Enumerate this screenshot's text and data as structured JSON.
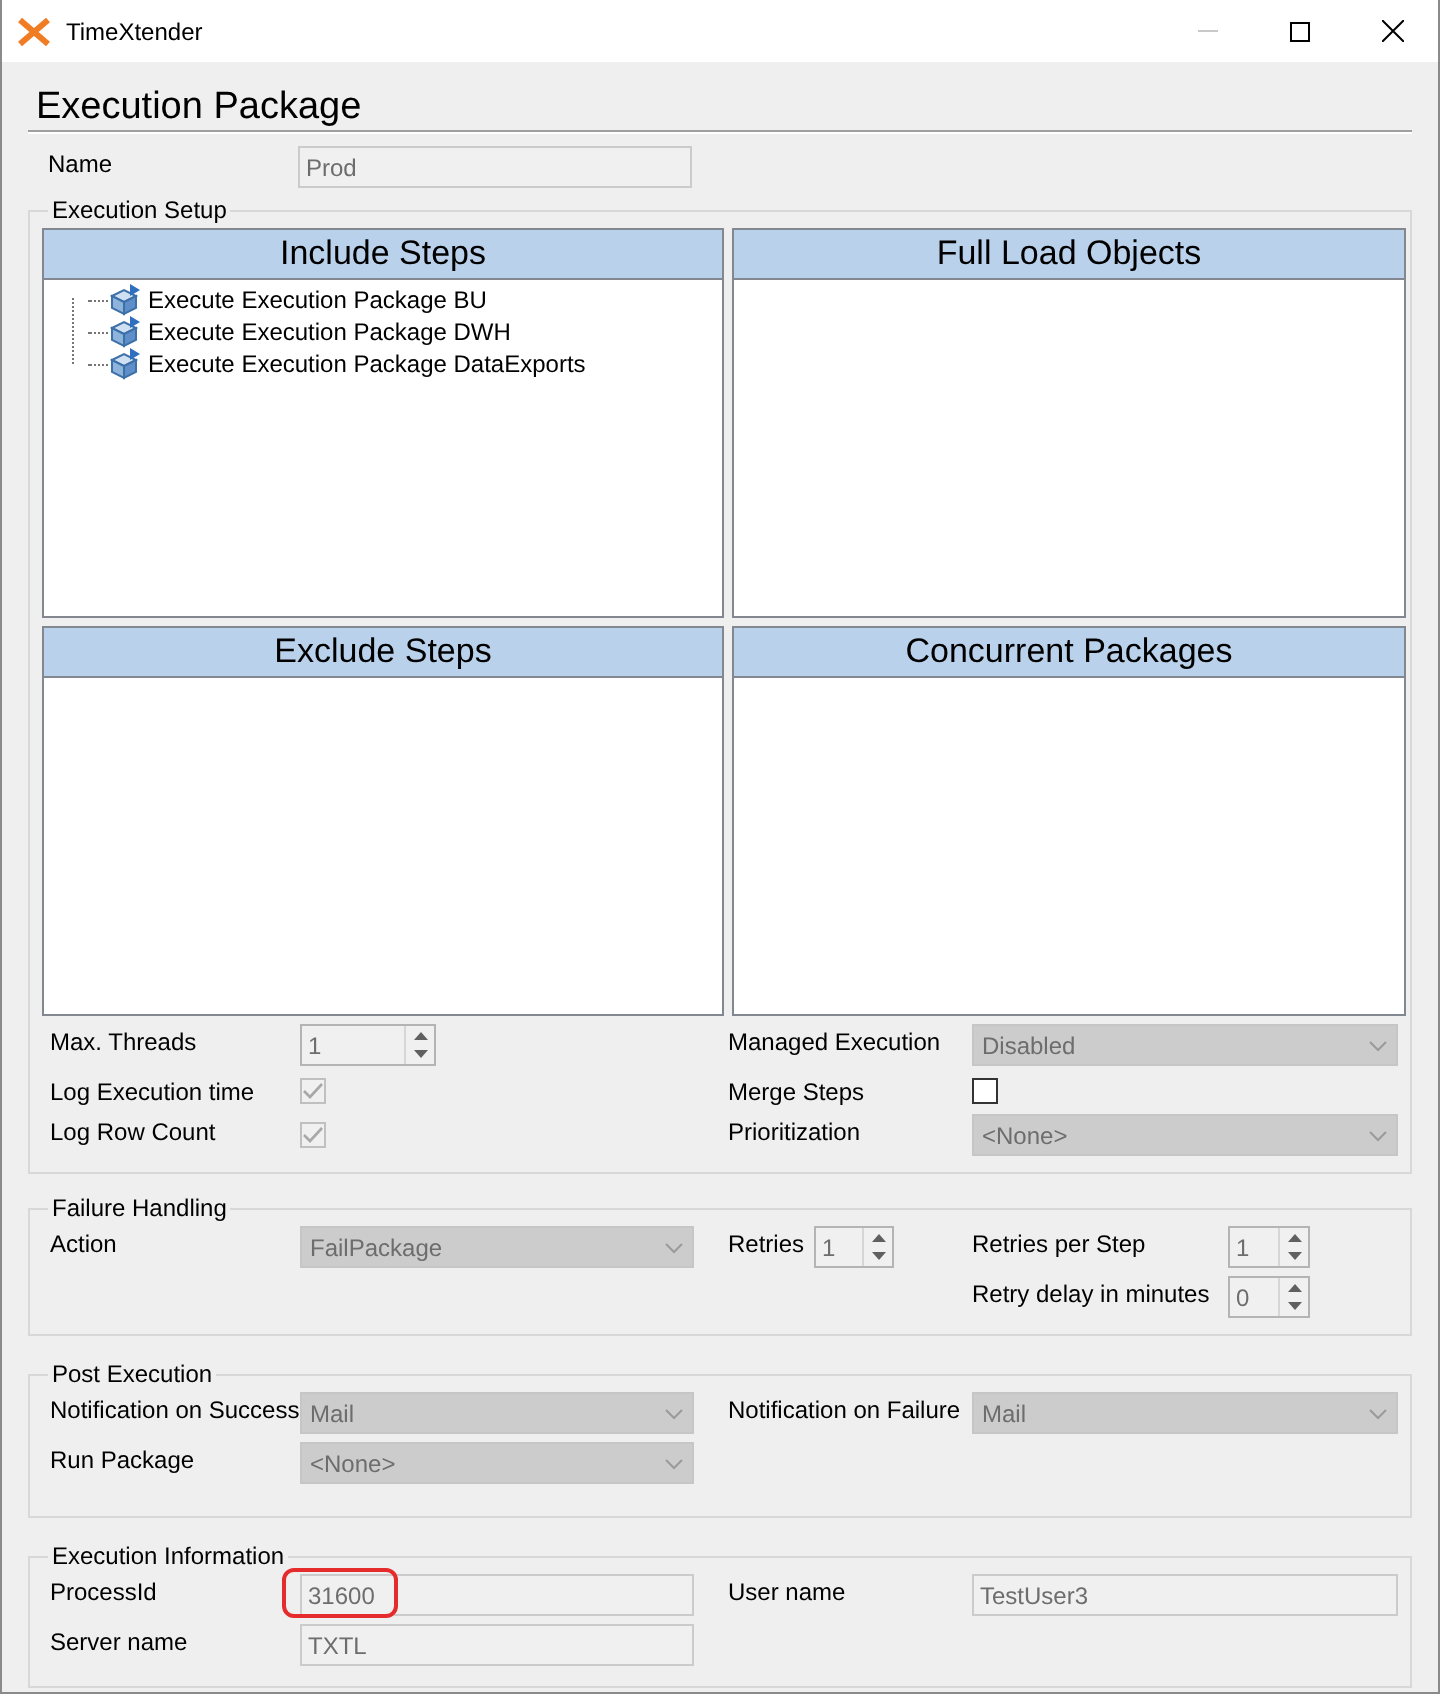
{
  "window": {
    "title": "TimeXtender",
    "minimize_disabled": true
  },
  "heading": "Execution Package",
  "name": {
    "label": "Name",
    "kind": "text",
    "value": "Prod",
    "disabled": true
  },
  "execution_setup": {
    "title": "Execution Setup",
    "panels": [
      {
        "title": "Include Steps",
        "items": [
          "Execute Execution Package BU",
          "Execute Execution Package DWH",
          "Execute Execution Package DataExports"
        ]
      },
      {
        "title": "Full Load Objects"
      },
      {
        "title": "Exclude Steps"
      },
      {
        "title": "Concurrent Packages"
      }
    ],
    "fields": [
      {
        "label": "Max. Threads",
        "kind": "spin",
        "value": "1",
        "disabled": true
      },
      {
        "label": "Managed Execution",
        "kind": "combo",
        "value": "Disabled",
        "disabled": true
      },
      {
        "label": "Log Execution time",
        "kind": "check",
        "checked": true,
        "disabled": true
      },
      {
        "label": "Merge Steps",
        "kind": "check",
        "checked": false,
        "disabled": false
      },
      {
        "label": "Log Row Count",
        "kind": "check",
        "checked": true,
        "disabled": true
      },
      {
        "label": "Prioritization",
        "kind": "combo",
        "value": "<None>",
        "disabled": true
      }
    ]
  },
  "failure_handling": {
    "title": "Failure Handling",
    "action": {
      "label": "Action",
      "kind": "combo",
      "value": "FailPackage",
      "disabled": true
    },
    "retries": {
      "label": "Retries",
      "kind": "spin",
      "value": "1",
      "disabled": true
    },
    "retries_per_step": {
      "label": "Retries per Step",
      "kind": "spin",
      "value": "1",
      "disabled": true
    },
    "retry_delay": {
      "label": "Retry delay in minutes",
      "kind": "spin",
      "value": "0",
      "disabled": true
    }
  },
  "post_execution": {
    "title": "Post Execution",
    "fields": [
      {
        "label": "Notification on Success",
        "kind": "combo",
        "value": "Mail",
        "disabled": true
      },
      {
        "label": "Notification on Failure",
        "kind": "combo",
        "value": "Mail",
        "disabled": true
      },
      {
        "label": "Run Package",
        "kind": "combo",
        "value": "<None>",
        "disabled": true
      }
    ]
  },
  "execution_information": {
    "title": "Execution Information",
    "fields": [
      {
        "label": "ProcessId",
        "kind": "text",
        "value": "31600",
        "disabled": true,
        "highlighted": true
      },
      {
        "label": "User name",
        "kind": "text",
        "value": "TestUser3",
        "disabled": true,
        "highlighted": false
      },
      {
        "label": "Server name",
        "kind": "text",
        "value": "TXTL",
        "disabled": true,
        "highlighted": false
      }
    ]
  }
}
